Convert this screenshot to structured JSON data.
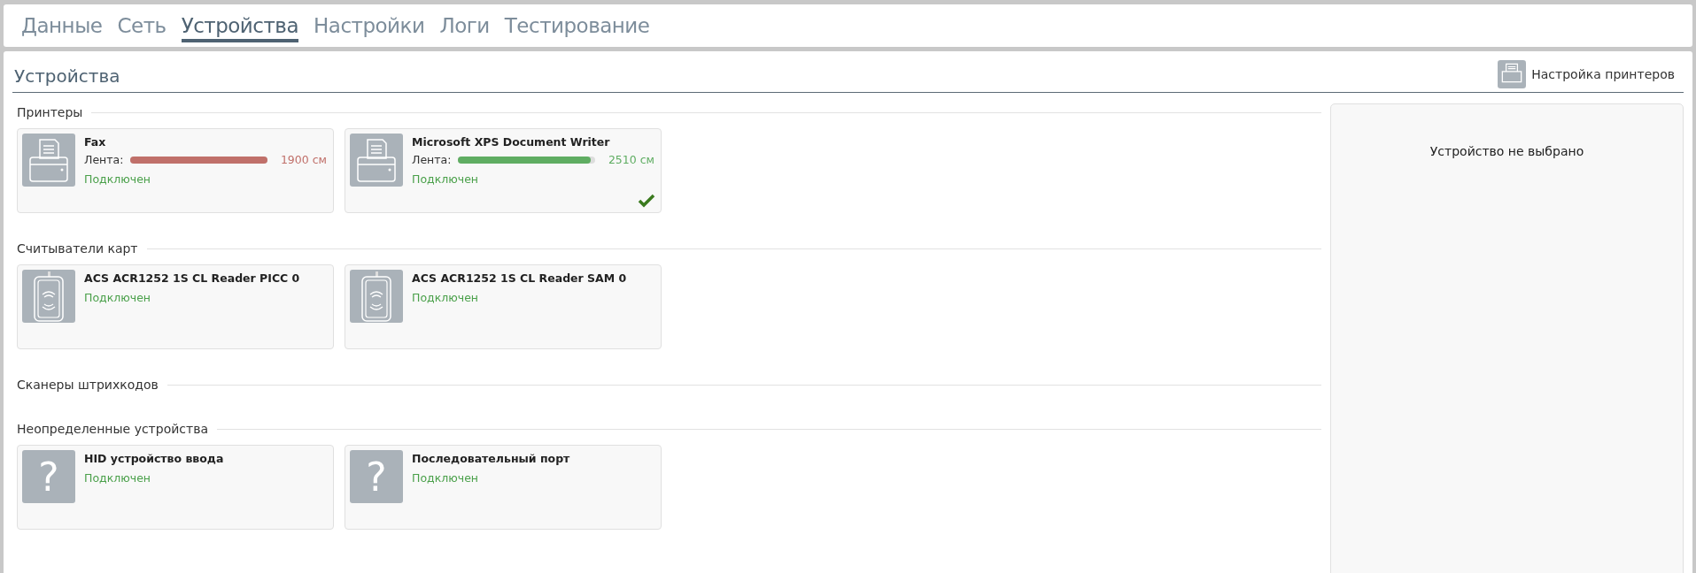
{
  "tabs": [
    {
      "label": "Данные",
      "selected": false
    },
    {
      "label": "Сеть",
      "selected": false
    },
    {
      "label": "Устройства",
      "selected": true
    },
    {
      "label": "Настройки",
      "selected": false
    },
    {
      "label": "Логи",
      "selected": false
    },
    {
      "label": "Тестирование",
      "selected": false
    }
  ],
  "page": {
    "title": "Устройства",
    "printer_settings_button": "Настройка принтеров"
  },
  "sections": [
    {
      "title": "Принтеры",
      "devices": [
        {
          "kind": "printer",
          "name": "Fax",
          "tape_label": "Лента:",
          "level": 1.0,
          "color": "#c0706a",
          "reading": "1900 см",
          "status": "Подключен",
          "selected": false
        },
        {
          "kind": "printer",
          "name": "Microsoft XPS Document Writer",
          "tape_label": "Лента:",
          "level": 0.97,
          "color": "#5fad62",
          "reading": "2510 см",
          "status": "Подключен",
          "selected": true
        }
      ]
    },
    {
      "title": "Считыватели карт",
      "devices": [
        {
          "kind": "card-reader",
          "name": "ACS ACR1252 1S CL Reader PICC 0",
          "status": "Подключен",
          "selected": false
        },
        {
          "kind": "card-reader",
          "name": "ACS ACR1252 1S CL Reader SAM 0",
          "status": "Подключен",
          "selected": false
        }
      ]
    },
    {
      "title": "Сканеры штрихкодов"
    },
    {
      "title": "Неопределенные устройства",
      "devices": [
        {
          "kind": "unknown",
          "icon_text": "?",
          "name": "HID устройство ввода",
          "status": "Подключен",
          "selected": false
        },
        {
          "kind": "unknown",
          "icon_text": "?",
          "name": "Последовательный порт",
          "status": "Подключен",
          "selected": false
        }
      ]
    }
  ],
  "details": {
    "empty_text": "Устройство не выбрано"
  }
}
